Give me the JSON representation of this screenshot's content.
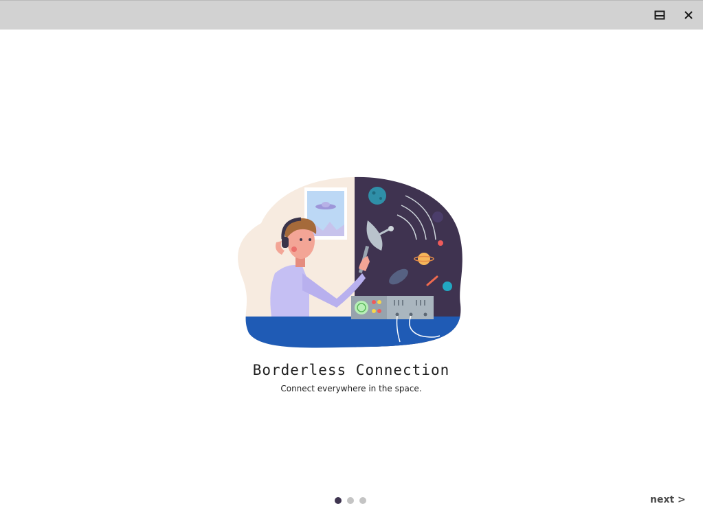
{
  "window": {
    "controls": [
      {
        "name": "maximize",
        "icon": "maximize-icon"
      },
      {
        "name": "close",
        "icon": "close-icon"
      }
    ]
  },
  "slide": {
    "illustration": "person-with-headphones-satellite-dish-space-illustration",
    "title": "Borderless Connection",
    "subtitle": "Connect everywhere in the space."
  },
  "pagination": {
    "total": 3,
    "active_index": 0,
    "active_color": "#3f3550",
    "inactive_color": "#c4c4c4"
  },
  "navigation": {
    "next_label": "next >"
  },
  "colors": {
    "titlebar": "#d2d2d2",
    "space": "#3f3350",
    "desk": "#1f5bb5",
    "wall": "#f7ebe0"
  }
}
